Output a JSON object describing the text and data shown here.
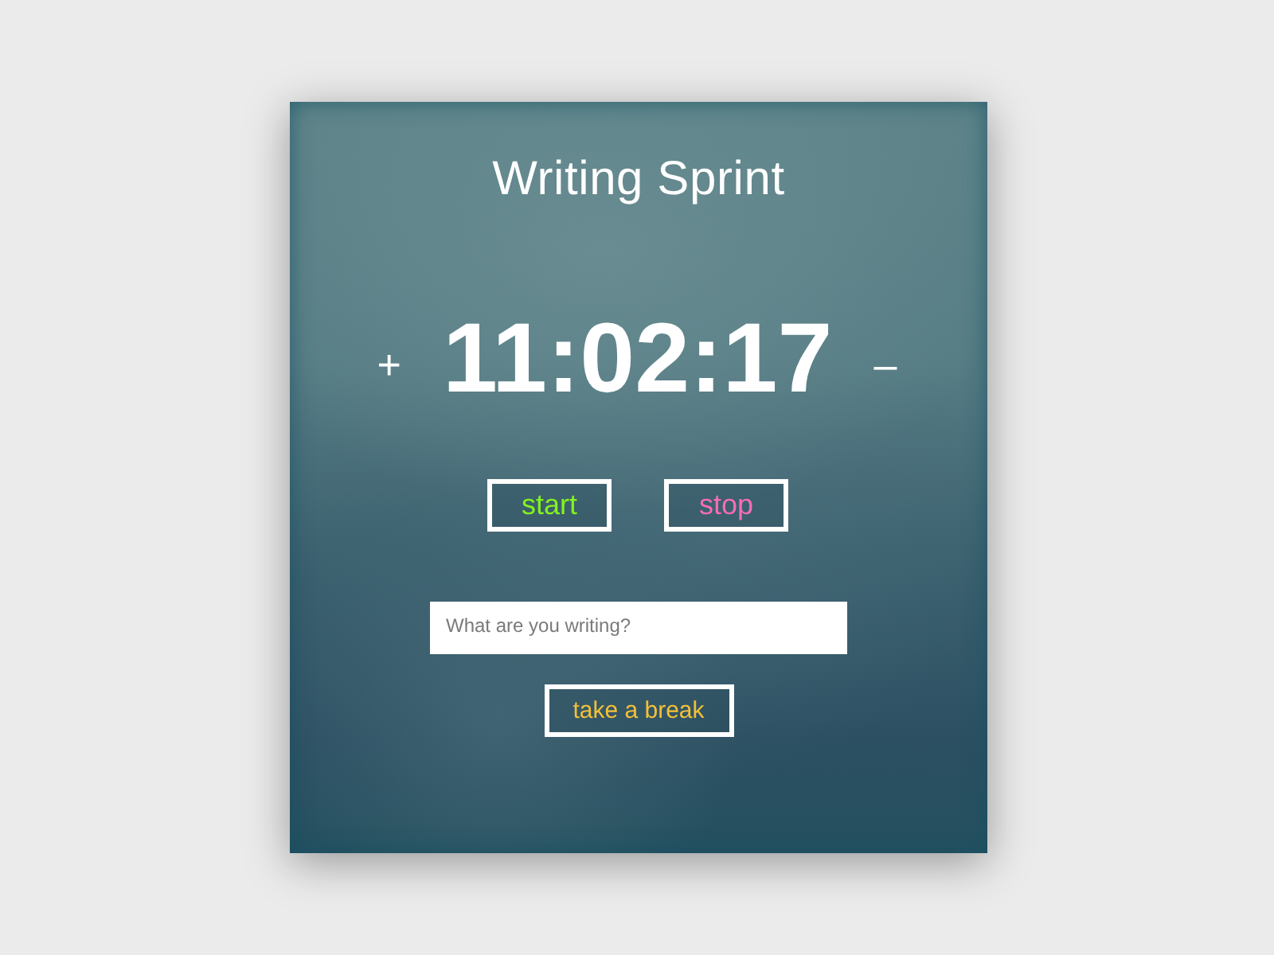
{
  "title": "Writing Sprint",
  "timer": {
    "increment": "+",
    "time": "11:02:17",
    "decrement": "–"
  },
  "buttons": [
    {
      "label": "start",
      "color": "#84f21f"
    },
    {
      "label": "stop",
      "color": "#f76cb8"
    }
  ],
  "task_field": {
    "placeholder": "What are you writing?"
  },
  "break_button": {
    "label": "take a break"
  }
}
